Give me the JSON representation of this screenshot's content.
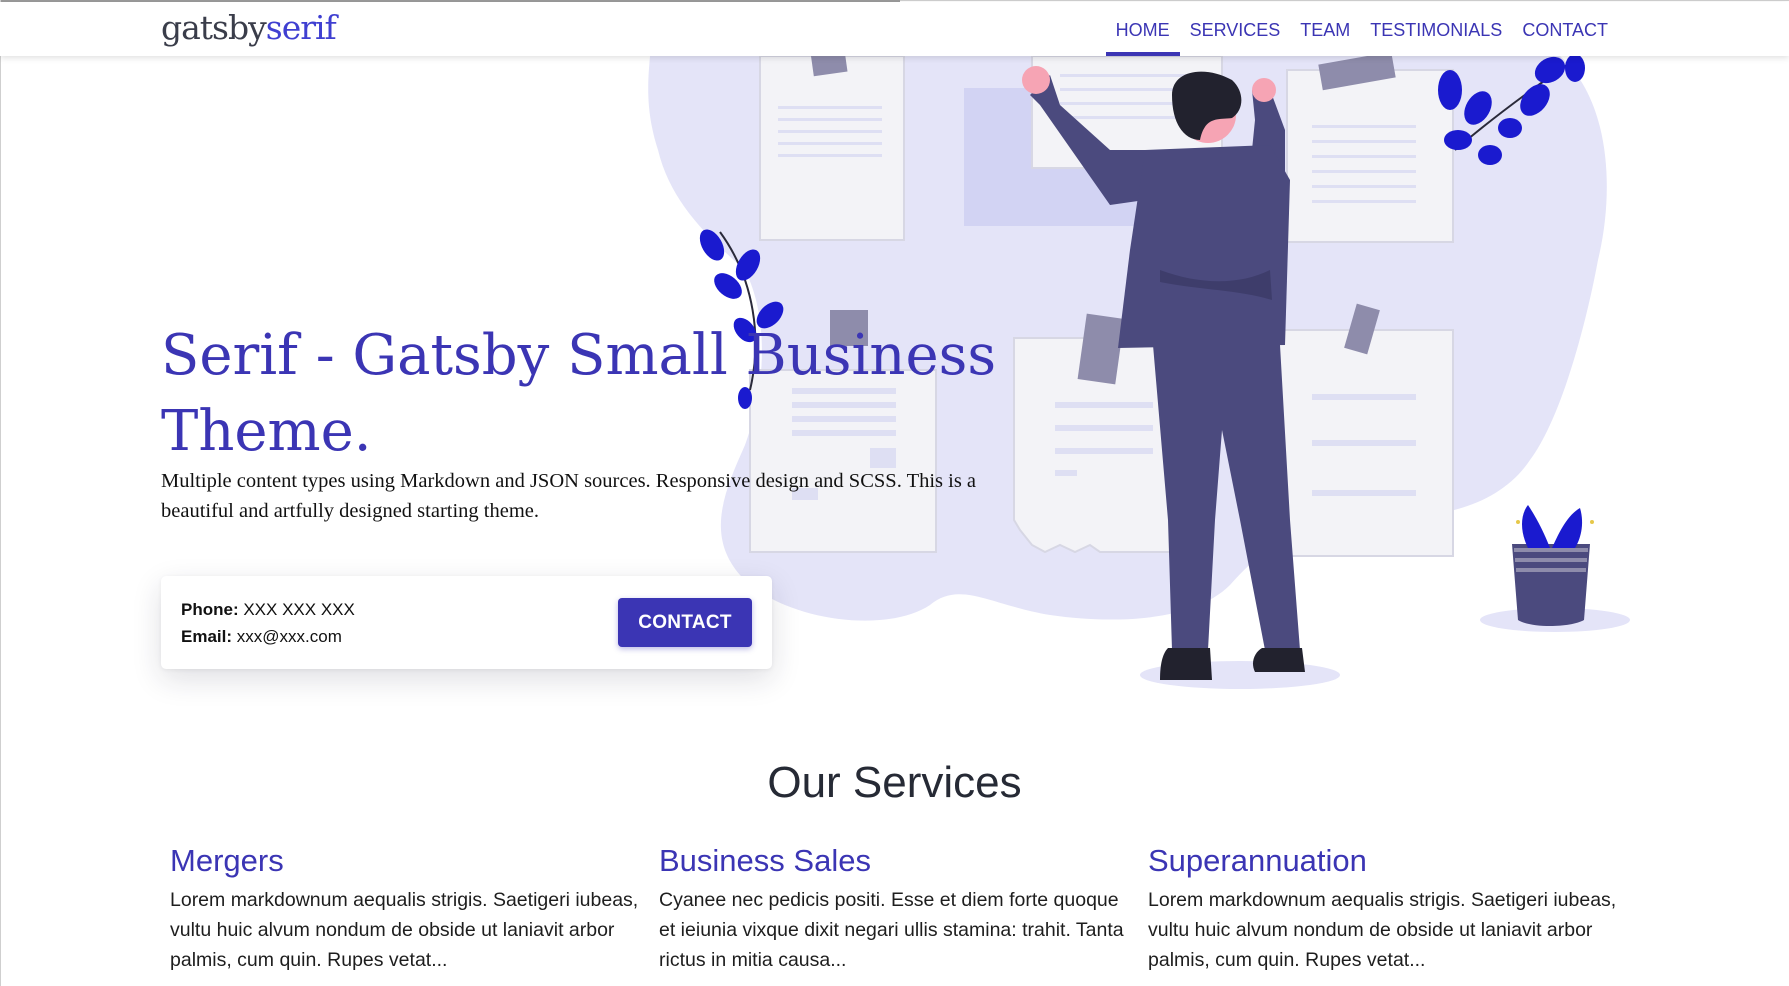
{
  "header": {
    "logo_part1": "gatsby",
    "logo_part2": "serif",
    "nav": [
      {
        "label": "HOME",
        "active": true
      },
      {
        "label": "SERVICES"
      },
      {
        "label": "TEAM"
      },
      {
        "label": "TESTIMONIALS"
      },
      {
        "label": "CONTACT"
      }
    ]
  },
  "hero": {
    "title": "Serif - Gatsby Small Business Theme.",
    "description": "Multiple content types using Markdown and JSON sources. Responsive design and SCSS. This is a beautiful and artfully designed starting theme."
  },
  "contact_card": {
    "phone_label": "Phone:",
    "phone_value": "XXX XXX XXX",
    "email_label": "Email:",
    "email_value": "xxx@xxx.com",
    "button_label": "CONTACT"
  },
  "services": {
    "heading": "Our Services",
    "items": [
      {
        "title": "Mergers",
        "text": "Lorem markdownum aequalis strigis. Saetigeri iubeas, vultu huic alvum nondum de obside ut laniavit arbor palmis, cum quin. Rupes vetat..."
      },
      {
        "title": "Business Sales",
        "text": "Cyanee nec pedicis positi. Esse et diem forte quoque et ieiunia vixque dixit negari ullis stamina: trahit. Tanta rictus in mitia causa..."
      },
      {
        "title": "Superannuation",
        "text": "Lorem markdownum aequalis strigis. Saetigeri iubeas, vultu huic alvum nondum de obside ut laniavit arbor palmis, cum quin. Rupes vetat..."
      }
    ]
  },
  "colors": {
    "accent": "#3b35b4",
    "illustration_bg": "#e4e4f8",
    "suit": "#4b4a7e",
    "leaf": "#1a1acf"
  },
  "icons": [
    "person-at-board-illustration",
    "leaf-branch-icon",
    "plant-pot-icon"
  ]
}
